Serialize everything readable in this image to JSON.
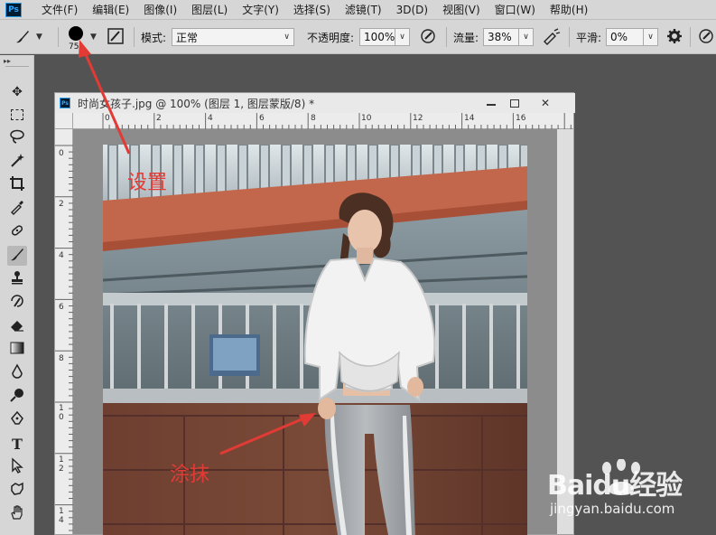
{
  "app": {
    "logo": "Ps",
    "menu": [
      "文件(F)",
      "编辑(E)",
      "图像(I)",
      "图层(L)",
      "文字(Y)",
      "选择(S)",
      "滤镜(T)",
      "3D(D)",
      "视图(V)",
      "窗口(W)",
      "帮助(H)"
    ]
  },
  "options": {
    "brush_size": "75",
    "mode_label": "模式:",
    "mode_value": "正常",
    "opacity_label": "不透明度:",
    "opacity_value": "100%",
    "flow_label": "流量:",
    "flow_value": "38%",
    "smoothing_label": "平滑:",
    "smoothing_value": "0%"
  },
  "document": {
    "title": "时尚女孩子.jpg @ 100% (图层 1, 图层蒙版/8) *",
    "ruler_top": [
      "0",
      "2",
      "4",
      "6",
      "8",
      "10",
      "12",
      "14",
      "16"
    ],
    "ruler_left": [
      "0",
      "2",
      "4",
      "6",
      "8",
      "1\n0",
      "1\n2",
      "1\n4"
    ]
  },
  "annotations": {
    "settings": "设置",
    "smear": "涂抹"
  },
  "watermark": {
    "brand": "Baidu经验",
    "site": "jingyan.baidu.com"
  },
  "colors": {
    "annotation": "#e23b35",
    "ui_bg": "#d6d6d6",
    "workspace": "#535353"
  }
}
